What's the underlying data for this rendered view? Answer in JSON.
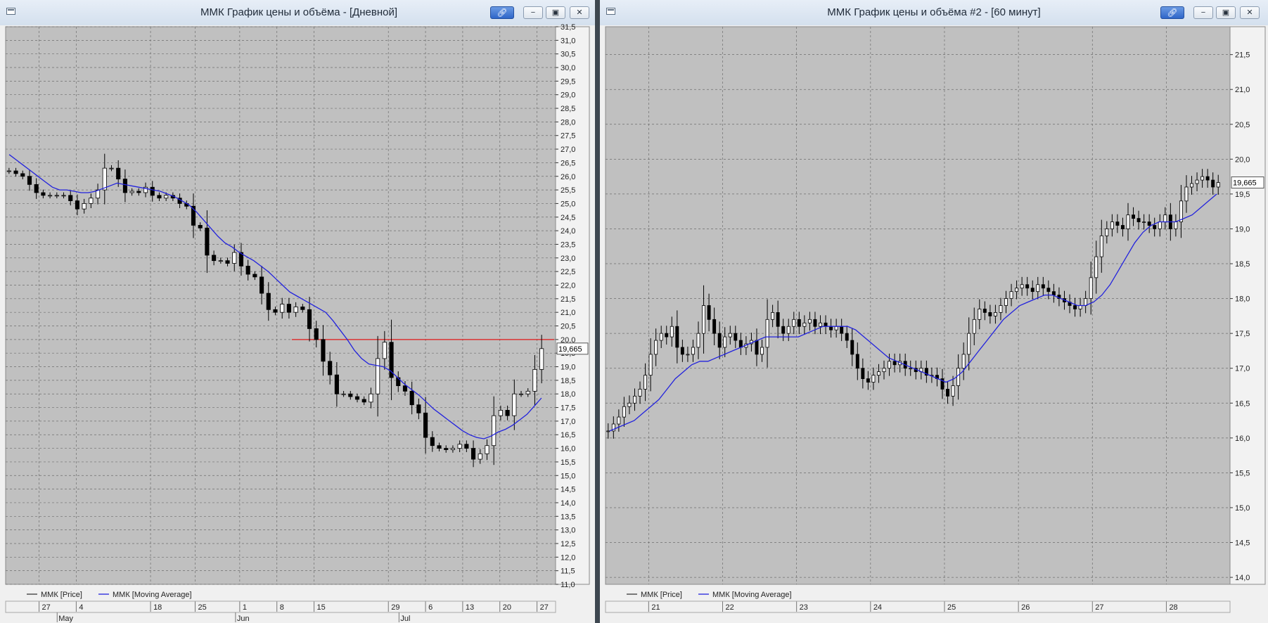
{
  "colors": {
    "plot_bg": "#c0c0c0",
    "grid": "#6e6e6e",
    "candle": "#000000",
    "ma": "#2222dd",
    "level": "#e01818",
    "panel": "#f0f0f0"
  },
  "windows": [
    {
      "title": "ММК График цены и объёма - [Дневной]",
      "buttons": {
        "link": "link-icon",
        "minimize": "minimize-icon",
        "restore": "restore-icon",
        "close": "close-icon"
      },
      "last_price_label": "19,665",
      "legend": {
        "price": "ММК [Price]",
        "ma": "ММК [Moving Average]"
      },
      "chart_data": {
        "type": "candlestick",
        "y_axis": {
          "min": 11.0,
          "max": 31.5,
          "step": 0.5,
          "labels": [
            "31,5",
            "31,0",
            "30,5",
            "30,0",
            "29,5",
            "29,0",
            "28,5",
            "28,0",
            "27,5",
            "27,0",
            "26,5",
            "26,0",
            "25,5",
            "25,0",
            "24,5",
            "24,0",
            "23,5",
            "23,0",
            "22,5",
            "22,0",
            "21,5",
            "21,0",
            "20,5",
            "20,0",
            "19,5",
            "19,0",
            "18,5",
            "18,0",
            "17,5",
            "17,0",
            "16,5",
            "16,0",
            "15,5",
            "15,0",
            "14,5",
            "14,0",
            "13,5",
            "13,0",
            "12,5",
            "12,0",
            "11,5",
            "11,0"
          ]
        },
        "x_ticks": [
          {
            "label": "27",
            "i": 4
          },
          {
            "label": "4",
            "i": 9
          },
          {
            "label": "18",
            "i": 19
          },
          {
            "label": "25",
            "i": 25
          },
          {
            "label": "1",
            "i": 31
          },
          {
            "label": "8",
            "i": 36
          },
          {
            "label": "15",
            "i": 41
          },
          {
            "label": "29",
            "i": 51
          },
          {
            "label": "6",
            "i": 56
          },
          {
            "label": "13",
            "i": 61
          },
          {
            "label": "20",
            "i": 66
          },
          {
            "label": "27",
            "i": 71
          }
        ],
        "month_labels": [
          {
            "label": "May",
            "i": 7
          },
          {
            "label": "Jun",
            "i": 31
          },
          {
            "label": "Jul",
            "i": 53
          }
        ],
        "x_count": 74,
        "hline": 20.0,
        "hline_from_i": 38,
        "last_price": 19.665,
        "close": [
          26.2,
          26.1,
          26.0,
          25.7,
          25.4,
          25.3,
          25.3,
          25.3,
          25.3,
          25.1,
          24.8,
          25.0,
          25.2,
          25.5,
          26.3,
          26.3,
          25.9,
          25.4,
          25.45,
          25.4,
          25.6,
          25.3,
          25.2,
          25.3,
          25.2,
          25.0,
          24.9,
          24.2,
          24.1,
          23.1,
          22.9,
          22.9,
          22.8,
          23.2,
          22.7,
          22.4,
          22.3,
          21.7,
          21.1,
          21.0,
          21.3,
          21.0,
          21.2,
          21.1,
          20.4,
          20.0,
          19.2,
          18.7,
          18.0,
          18.0,
          17.9,
          17.8,
          17.7,
          18.0,
          19.3,
          19.9,
          18.6,
          18.3,
          18.1,
          17.6,
          17.3,
          16.4,
          16.1,
          16.0,
          15.95,
          16.0,
          16.15,
          16.0,
          15.6,
          15.8,
          16.1,
          17.2,
          17.4,
          17.2,
          18.0,
          18.0,
          18.1,
          18.9,
          19.665
        ],
        "moving_average": [
          26.8,
          26.6,
          26.4,
          26.2,
          26.0,
          25.8,
          25.6,
          25.5,
          25.5,
          25.45,
          25.4,
          25.4,
          25.45,
          25.55,
          25.65,
          25.75,
          25.7,
          25.65,
          25.6,
          25.55,
          25.5,
          25.45,
          25.35,
          25.25,
          25.1,
          24.95,
          24.7,
          24.4,
          24.1,
          23.8,
          23.55,
          23.4,
          23.2,
          23.05,
          22.9,
          22.7,
          22.5,
          22.25,
          22.0,
          21.75,
          21.6,
          21.45,
          21.3,
          21.15,
          21.0,
          20.7,
          20.35,
          20.0,
          19.6,
          19.3,
          19.1,
          19.05,
          19.0,
          18.85,
          18.6,
          18.35,
          18.15,
          17.95,
          17.7,
          17.45,
          17.25,
          17.05,
          16.85,
          16.65,
          16.5,
          16.4,
          16.35,
          16.45,
          16.6,
          16.7,
          16.85,
          17.05,
          17.25,
          17.55,
          17.85
        ]
      }
    },
    {
      "title": "ММК График цены и объёма #2 - [60 минут]",
      "buttons": {
        "link": "link-icon",
        "minimize": "minimize-icon",
        "restore": "restore-icon",
        "close": "close-icon"
      },
      "last_price_label": "19,665",
      "legend": {
        "price": "ММК [Price]",
        "ma": "ММК [Moving Average]"
      },
      "chart_data": {
        "type": "candlestick",
        "y_axis": {
          "min": 13.9,
          "max": 21.9,
          "step": 0.5,
          "labels": [
            "21,5",
            "21,0",
            "20,5",
            "20,0",
            "19,5",
            "19,0",
            "18,5",
            "18,0",
            "17,5",
            "17,0",
            "16,5",
            "16,0",
            "15,5",
            "15,0",
            "14,5",
            "14,0"
          ],
          "ticks": [
            21.5,
            21.0,
            20.5,
            20.0,
            19.5,
            19.0,
            18.5,
            18.0,
            17.5,
            17.0,
            16.5,
            16.0,
            15.5,
            15.0,
            14.5,
            14.0
          ]
        },
        "x_ticks": [
          {
            "label": "21",
            "i": 10
          },
          {
            "label": "22",
            "i": 28
          },
          {
            "label": "23",
            "i": 46
          },
          {
            "label": "24",
            "i": 64
          },
          {
            "label": "25",
            "i": 82
          },
          {
            "label": "26",
            "i": 100
          },
          {
            "label": "27",
            "i": 118
          },
          {
            "label": "28",
            "i": 136
          }
        ],
        "x_count": 152,
        "last_price": 19.665,
        "close": [
          16.1,
          16.2,
          16.3,
          16.45,
          16.5,
          16.6,
          16.7,
          16.9,
          17.2,
          17.4,
          17.5,
          17.45,
          17.6,
          17.3,
          17.2,
          17.2,
          17.3,
          17.5,
          17.9,
          17.7,
          17.5,
          17.3,
          17.45,
          17.5,
          17.4,
          17.3,
          17.35,
          17.4,
          17.2,
          17.3,
          17.7,
          17.8,
          17.6,
          17.5,
          17.6,
          17.7,
          17.6,
          17.65,
          17.7,
          17.6,
          17.65,
          17.6,
          17.55,
          17.6,
          17.5,
          17.4,
          17.2,
          17.0,
          16.85,
          16.8,
          16.9,
          16.95,
          17.0,
          17.1,
          17.05,
          17.1,
          17.0,
          17.0,
          16.95,
          17.0,
          16.9,
          16.9,
          16.85,
          16.7,
          16.6,
          16.75,
          17.0,
          17.2,
          17.5,
          17.7,
          17.85,
          17.8,
          17.75,
          17.8,
          17.9,
          18.0,
          18.1,
          18.15,
          18.2,
          18.15,
          18.1,
          18.2,
          18.15,
          18.1,
          18.05,
          18.0,
          17.95,
          17.9,
          17.85,
          17.9,
          18.0,
          18.3,
          18.6,
          18.9,
          19.0,
          19.1,
          19.05,
          19.0,
          19.2,
          19.15,
          19.1,
          19.1,
          19.05,
          19.0,
          19.1,
          19.2,
          19.0,
          19.1,
          19.4,
          19.6,
          19.65,
          19.7,
          19.75,
          19.7,
          19.6,
          19.665
        ],
        "moving_average": [
          16.1,
          16.15,
          16.2,
          16.25,
          16.35,
          16.45,
          16.55,
          16.7,
          16.85,
          16.95,
          17.05,
          17.1,
          17.1,
          17.15,
          17.2,
          17.25,
          17.3,
          17.35,
          17.4,
          17.45,
          17.45,
          17.45,
          17.45,
          17.45,
          17.5,
          17.55,
          17.6,
          17.6,
          17.6,
          17.6,
          17.55,
          17.45,
          17.35,
          17.25,
          17.15,
          17.1,
          17.05,
          17.0,
          16.95,
          16.9,
          16.85,
          16.8,
          16.85,
          16.95,
          17.1,
          17.25,
          17.4,
          17.55,
          17.7,
          17.8,
          17.9,
          17.95,
          18.0,
          18.05,
          18.05,
          18.0,
          17.95,
          17.9,
          17.9,
          17.95,
          18.05,
          18.2,
          18.4,
          18.6,
          18.8,
          18.95,
          19.05,
          19.1,
          19.1,
          19.1,
          19.15,
          19.2,
          19.3,
          19.4,
          19.5
        ]
      }
    }
  ]
}
